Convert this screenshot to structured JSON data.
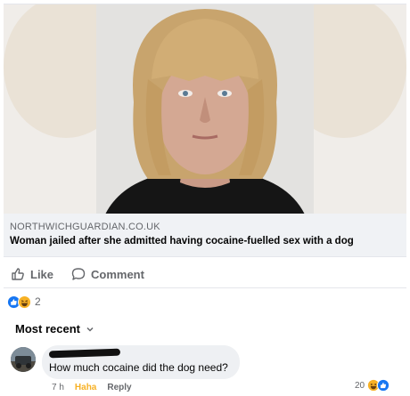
{
  "link_preview": {
    "domain": "NORTHWICHGUARDIAN.CO.UK",
    "title": "Woman jailed after she admitted having cocaine-fuelled sex with a dog"
  },
  "actions": {
    "like_label": "Like",
    "comment_label": "Comment"
  },
  "reactions": {
    "types": [
      "like-icon",
      "haha-icon"
    ],
    "count": "2"
  },
  "comments_section": {
    "sort_label": "Most recent"
  },
  "comment": {
    "text": "How much cocaine did the dog need?",
    "time": "7 h",
    "reaction_label": "Haha",
    "reply_label": "Reply",
    "reaction_count": "20"
  },
  "colors": {
    "facebook_blue": "#1877f2",
    "haha_yellow": "#f7b125",
    "secondary_text": "#65676b"
  }
}
